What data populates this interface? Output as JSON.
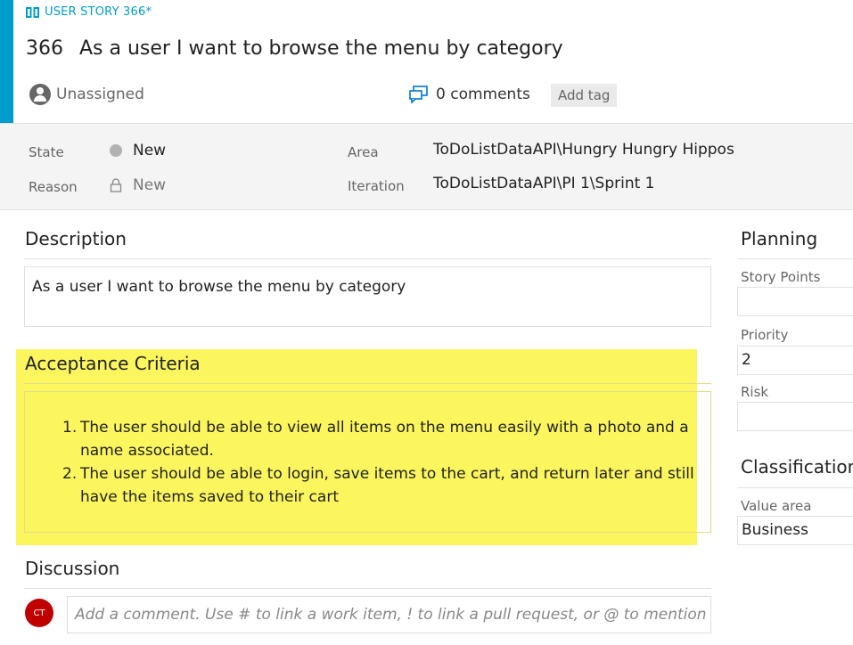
{
  "header": {
    "type_label": "USER STORY 366*",
    "id": "366",
    "title": "As a user I want to browse the menu by category",
    "assignee": "Unassigned",
    "comments": "0 comments",
    "add_tag": "Add tag"
  },
  "meta": {
    "state_label": "State",
    "state_value": "New",
    "reason_label": "Reason",
    "reason_value": "New",
    "area_label": "Area",
    "area_value": "ToDoListDataAPI\\Hungry Hungry Hippos",
    "iteration_label": "Iteration",
    "iteration_value": "ToDoListDataAPI\\PI 1\\Sprint 1"
  },
  "description": {
    "title": "Description",
    "text": "As a user I want to browse the menu by category"
  },
  "acceptance": {
    "title": "Acceptance Criteria",
    "items": [
      {
        "num": "1.",
        "text": "The user should be able to view all items on the menu easily with a photo and a name associated."
      },
      {
        "num": "2.",
        "text": "The user should be able to login, save items to the cart, and return later and still have the items saved to their cart"
      }
    ]
  },
  "discussion": {
    "title": "Discussion",
    "avatar_initials": "CT",
    "placeholder": "Add a comment. Use # to link a work item, ! to link a pull request, or @ to mention a"
  },
  "planning": {
    "title": "Planning",
    "story_points_label": "Story Points",
    "story_points_value": "",
    "priority_label": "Priority",
    "priority_value": "2",
    "risk_label": "Risk",
    "risk_value": ""
  },
  "classification": {
    "title": "Classification",
    "value_area_label": "Value area",
    "value_area_value": "Business"
  },
  "colors": {
    "accent": "#009ccc",
    "highlight": "#fbf55e",
    "avatar": "#c00000"
  },
  "icons": {
    "type": "book-icon",
    "assignee": "user-avatar-icon",
    "comments": "comments-icon",
    "reason": "lock-icon"
  }
}
